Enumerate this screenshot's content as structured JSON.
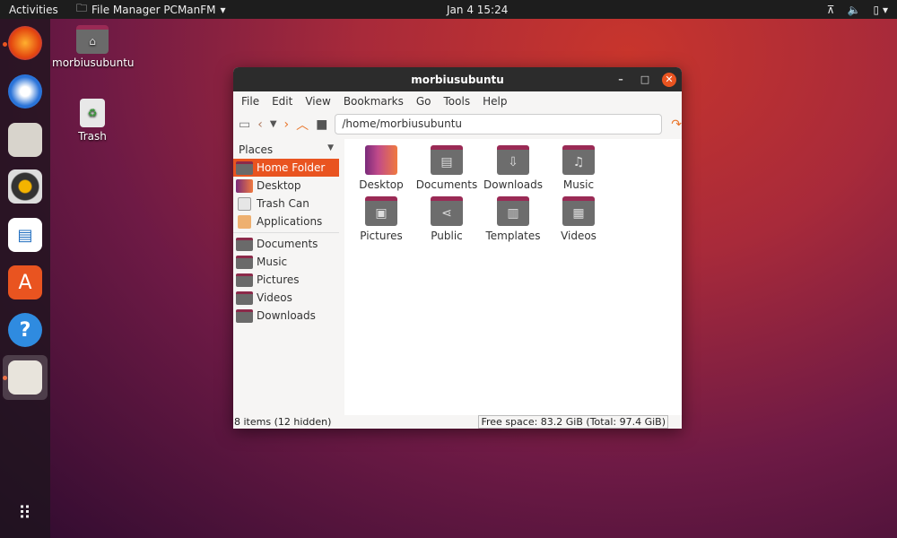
{
  "topbar": {
    "activities": "Activities",
    "app_name": "File Manager PCManFM",
    "clock": "Jan 4  15:24"
  },
  "dock": {
    "items": [
      "firefox",
      "thunderbird",
      "files",
      "rhythmbox",
      "libreoffice-writer",
      "ubuntu-software",
      "help",
      "pcmanfm"
    ],
    "show_apps": "show-applications"
  },
  "desktop": {
    "icons": [
      {
        "label": "morbiusubuntu"
      },
      {
        "label": "Trash"
      }
    ]
  },
  "window": {
    "title": "morbiusubuntu",
    "menu": [
      "File",
      "Edit",
      "View",
      "Bookmarks",
      "Go",
      "Tools",
      "Help"
    ],
    "location": "/home/morbiusubuntu",
    "sidebar": {
      "header": "Places",
      "places": [
        "Home Folder",
        "Desktop",
        "Trash Can",
        "Applications"
      ],
      "bookmarks": [
        "Documents",
        "Music",
        "Pictures",
        "Videos",
        "Downloads"
      ],
      "selected": "Home Folder"
    },
    "files": [
      {
        "name": "Desktop",
        "icon": "desktop"
      },
      {
        "name": "Documents",
        "icon": "document"
      },
      {
        "name": "Downloads",
        "icon": "download"
      },
      {
        "name": "Music",
        "icon": "music"
      },
      {
        "name": "Pictures",
        "icon": "picture"
      },
      {
        "name": "Public",
        "icon": "share"
      },
      {
        "name": "Templates",
        "icon": "template"
      },
      {
        "name": "Videos",
        "icon": "video"
      }
    ],
    "status": {
      "items": "8 items (12 hidden)",
      "free_space": "Free space: 83.2 GiB (Total: 97.4 GiB)"
    }
  },
  "colors": {
    "accent": "#e95420",
    "titlebar": "#2c2c2c"
  }
}
